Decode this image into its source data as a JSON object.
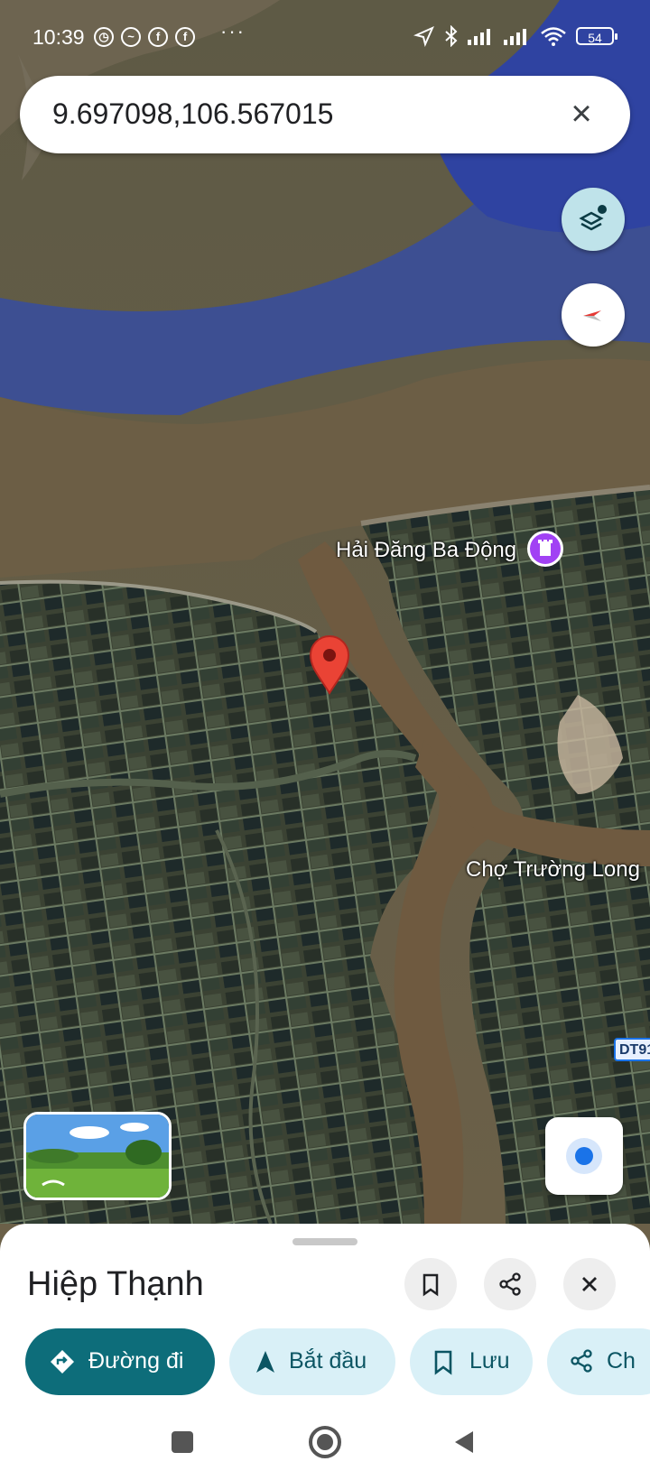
{
  "status_bar": {
    "time": "10:39",
    "battery": "54"
  },
  "search": {
    "query": "9.697098,106.567015"
  },
  "map": {
    "labels": {
      "lighthouse": "Hải Đăng Ba Động",
      "market": "Chợ Trường Long",
      "road": "DT91"
    }
  },
  "place": {
    "name": "Hiệp Thạnh",
    "actions": [
      {
        "label": "Đường đi"
      },
      {
        "label": "Bắt đầu"
      },
      {
        "label": "Lưu"
      },
      {
        "label": "Ch"
      }
    ]
  },
  "colors": {
    "accent": "#0d6d7a",
    "chip": "#d9f0f7",
    "pin": "#ea4335",
    "poi": "#a142f4",
    "location": "#1a73e8"
  },
  "icons": [
    "search-close-icon",
    "layers-icon",
    "compass-icon",
    "map-pin-icon",
    "lighthouse-icon",
    "my-location-icon",
    "bookmark-icon",
    "share-icon",
    "close-icon",
    "directions-icon",
    "navigation-icon",
    "save-icon",
    "recents-icon",
    "home-icon",
    "back-icon"
  ]
}
